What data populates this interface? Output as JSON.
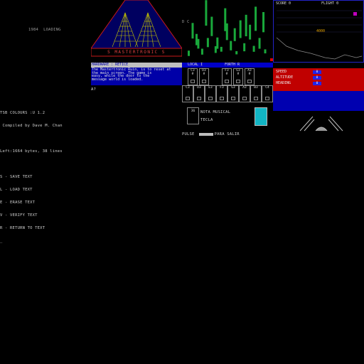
{
  "editor": {
    "loading": "1984  LOADING",
    "lines": [
      "TSB COLOURS :U 1.2",
      " Compiled by Dave M. Chan",
      "",
      "Left:1664 bytes, 38 lines",
      "",
      "S - SAVE TEXT",
      "L - LOAD TEXT",
      "E - ERASE TEXT",
      "V - VERIFY TEXT",
      "R - RETURN TO TEXT",
      "_"
    ]
  },
  "mastertronic": {
    "banner": "S MASTERTRONIC S",
    "message_title": "HARDWARE : RETICE",
    "message_body": "The Mastertronic Ruin, is to reset at\nthe main screen. The game is\neasy, while the door to the\nmessage world is loaded.",
    "prompt": "A?"
  },
  "music": {
    "left_label": "D C",
    "header_left": "LOCAL  I",
    "header_right": "FORTH  R",
    "top_keys": [
      "C3",
      "D3",
      "F3",
      "G3",
      "A3"
    ],
    "top_key_vals": [
      "#",
      "#",
      "#",
      "#",
      "#"
    ],
    "bottom_keys": [
      "C3",
      "D3",
      "E3",
      "F3",
      "G3",
      "A3",
      "B3",
      "C4"
    ],
    "instrument_box": "36",
    "instrument_label1": "NOTA MUSICAL",
    "instrument_label2": "TECLA",
    "pulse": "PULSE",
    "pulse_right": "PARA SALIR",
    "bar_heights": [
      0.2,
      0.58,
      0.42,
      0.36,
      0.22,
      0.95,
      0.34,
      0.72,
      0.25,
      0.42,
      0.18,
      0.85,
      0.62,
      0.35,
      0.48,
      0.12,
      0.66,
      0.3,
      0.8,
      0.55,
      0.22,
      0.9,
      0.4,
      0.75,
      0.15
    ],
    "bar_color": "#19a83b"
  },
  "flight": {
    "score_label": "SCORE 0",
    "flight_label": "FLIGHT 0",
    "radar_text": "4000",
    "stats": [
      {
        "label": "SPEED",
        "value": "0"
      },
      {
        "label": "ALTITUDE",
        "value": "0"
      },
      {
        "label": "HEADING",
        "value": "0"
      }
    ]
  }
}
